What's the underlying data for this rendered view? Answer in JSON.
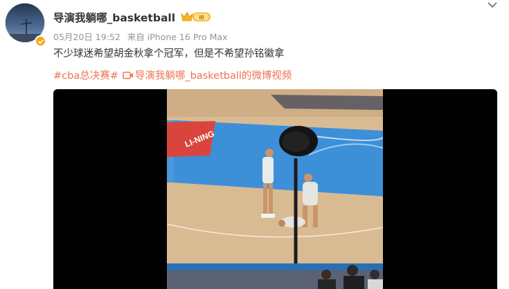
{
  "post": {
    "username": "导演我躺哪_basketball",
    "member_level": "III",
    "date": "05月20日 19:52",
    "source": "来自 iPhone 16 Pro Max",
    "text": "不少球迷希望胡金秋拿个冠军，但是不希望孙铭徽拿",
    "hashtag": "#cba总决赛#",
    "video_link": "导演我躺哪_basketball的微博视频"
  },
  "video": {
    "court_logo": "LI-NING"
  },
  "colors": {
    "link": "#eb7350",
    "badge": "#f7a71b",
    "court_blue": "#3d8fd8",
    "court_wood": "#d9b98f"
  },
  "icons": {
    "expand": "chevron-down-icon",
    "verified": "verified-icon",
    "video": "video-icon"
  }
}
